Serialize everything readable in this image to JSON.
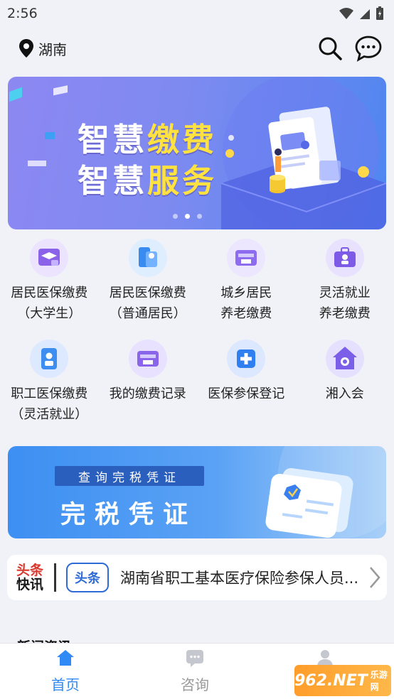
{
  "status_bar": {
    "time": "2:56"
  },
  "header": {
    "location": "湖南"
  },
  "banner": {
    "line1_a": "智慧",
    "line1_b": "缴费",
    "line2_a": "智慧",
    "line2_b": "服务",
    "active_slide": 1,
    "slide_count": 3
  },
  "services": [
    {
      "line1": "居民医保缴费",
      "line2": "（大学生）",
      "icon": "graduation-card-icon"
    },
    {
      "line1": "居民医保缴费",
      "line2": "（普通居民）",
      "icon": "building-payment-icon"
    },
    {
      "line1": "城乡居民",
      "line2": "养老缴费",
      "icon": "pension-card-icon"
    },
    {
      "line1": "灵活就业",
      "line2": "养老缴费",
      "icon": "briefcase-user-icon"
    },
    {
      "line1": "职工医保缴费",
      "line2": "（灵活就业）",
      "icon": "badge-user-icon"
    },
    {
      "line1": "我的缴费记录",
      "line2": "",
      "icon": "payment-record-icon"
    },
    {
      "line1": "医保参保登记",
      "line2": "",
      "icon": "medical-register-icon"
    },
    {
      "line1": "湘入会",
      "line2": "",
      "icon": "home-union-icon"
    }
  ],
  "tax_card": {
    "pill": "查询完税凭证",
    "title": "完税凭证"
  },
  "news_bar": {
    "logo_top": "头条",
    "logo_bottom": "快讯",
    "tag": "头条",
    "headline": "湖南省职工基本医疗保险参保人员..."
  },
  "section": {
    "title": "新闻资讯"
  },
  "tabbar": {
    "home": "首页",
    "consult": "咨询",
    "profile": "我的"
  },
  "watermark": {
    "text": "962.NET",
    "sub": "乐游网"
  },
  "colors": {
    "accent": "#2f6bd6",
    "banner_highlight": "#ffe23f"
  }
}
